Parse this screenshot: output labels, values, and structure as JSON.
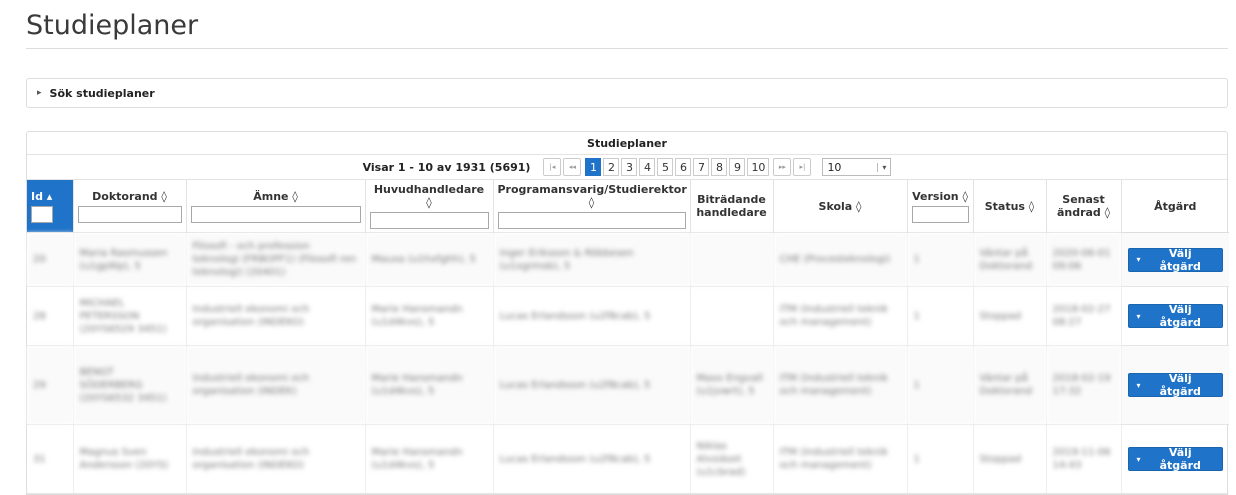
{
  "page": {
    "title": "Studieplaner"
  },
  "search_panel": {
    "label": "Sök studieplaner"
  },
  "table": {
    "caption": "Studieplaner",
    "paginator": {
      "info": "Visar 1 - 10 av 1931  (5691)",
      "pages": [
        "1",
        "2",
        "3",
        "4",
        "5",
        "6",
        "7",
        "8",
        "9",
        "10"
      ],
      "current_page": "1",
      "first_glyph": "|◂",
      "prev_glyph": "◂◂",
      "next_glyph": "▸▸",
      "last_glyph": "▸|",
      "rows_per_page": "10",
      "rows_arrow": "▾"
    },
    "columns": [
      {
        "label": "Id ▴"
      },
      {
        "label": "Doktorand ◊"
      },
      {
        "label": "Ämne ◊"
      },
      {
        "label": "Huvudhandledare ◊"
      },
      {
        "label": "Programansvarig/Studierektor ◊"
      },
      {
        "label": "Biträdande handledare"
      },
      {
        "label": "Skola ◊"
      },
      {
        "label": "Version ◊"
      },
      {
        "label": "Status ◊"
      },
      {
        "label": "Senast ändrad ◊"
      },
      {
        "label": "Åtgärd"
      }
    ],
    "action_label": "Välj åtgärd",
    "action_caret": "▾",
    "rows": [
      {
        "id": "20",
        "doktorand": "Maria Rasmussen (u1gp9lp), 5",
        "amne": "Filosofi - och profession teknologi (FRBOPF1) (Filosofi ren teknologi) (20401)",
        "huvud": "Mauxa (u1hxfghh), 5",
        "prog": "Inger Eriksson & Röbbesen (u1xgrmsb), 5",
        "bitr": "",
        "skola": "CHE (Procesteknologi)",
        "version": "1",
        "status": "Väntar på Doktorand",
        "andrad": "2020-06-01 09:06"
      },
      {
        "id": "28",
        "doktorand": "MICHAEL PETERSSON (20YS6529 3451)",
        "amne": "Industriell ekonomi och organisation (INDEKO)",
        "huvud": "Marie Hansmandn (u1d4kvs), 5",
        "prog": "Lucas Erlandsson (u2f8cab), 5",
        "bitr": "",
        "skola": "ITM (Industriell teknik och management)",
        "version": "1",
        "status": "Stoppad",
        "andrad": "2018-02-27 08:27"
      },
      {
        "id": "29",
        "doktorand": "BENGT SÖDERBERG (20YS6532 3451)",
        "amne": "Industriell ekonomi och organisation (INDEK)",
        "huvud": "Marie Hansmandn (u1d4kvs), 5",
        "prog": "Lucas Erlandsson (u2f8cab), 5",
        "bitr": "Maxx Engvall (u1jvwrt), 5",
        "skola": "ITM (Industriell teknik och management)",
        "version": "1",
        "status": "Väntar på Doktorand",
        "andrad": "2018-02-19 17:32"
      },
      {
        "id": "31",
        "doktorand": "Magnus Sven Andersson (20YS)",
        "amne": "Industriell ekonomi och organisation (INDEKO)",
        "huvud": "Marie Hansmandn (u1d4kvs), 5",
        "prog": "Lucas Erlandsson (u2f8cab), 5",
        "bitr": "Niklas Alvsiäset (u1cbrad)",
        "skola": "ITM (Industriell teknik och management)",
        "version": "1",
        "status": "Stoppad",
        "andrad": "2019-11-06 14:43"
      }
    ]
  }
}
